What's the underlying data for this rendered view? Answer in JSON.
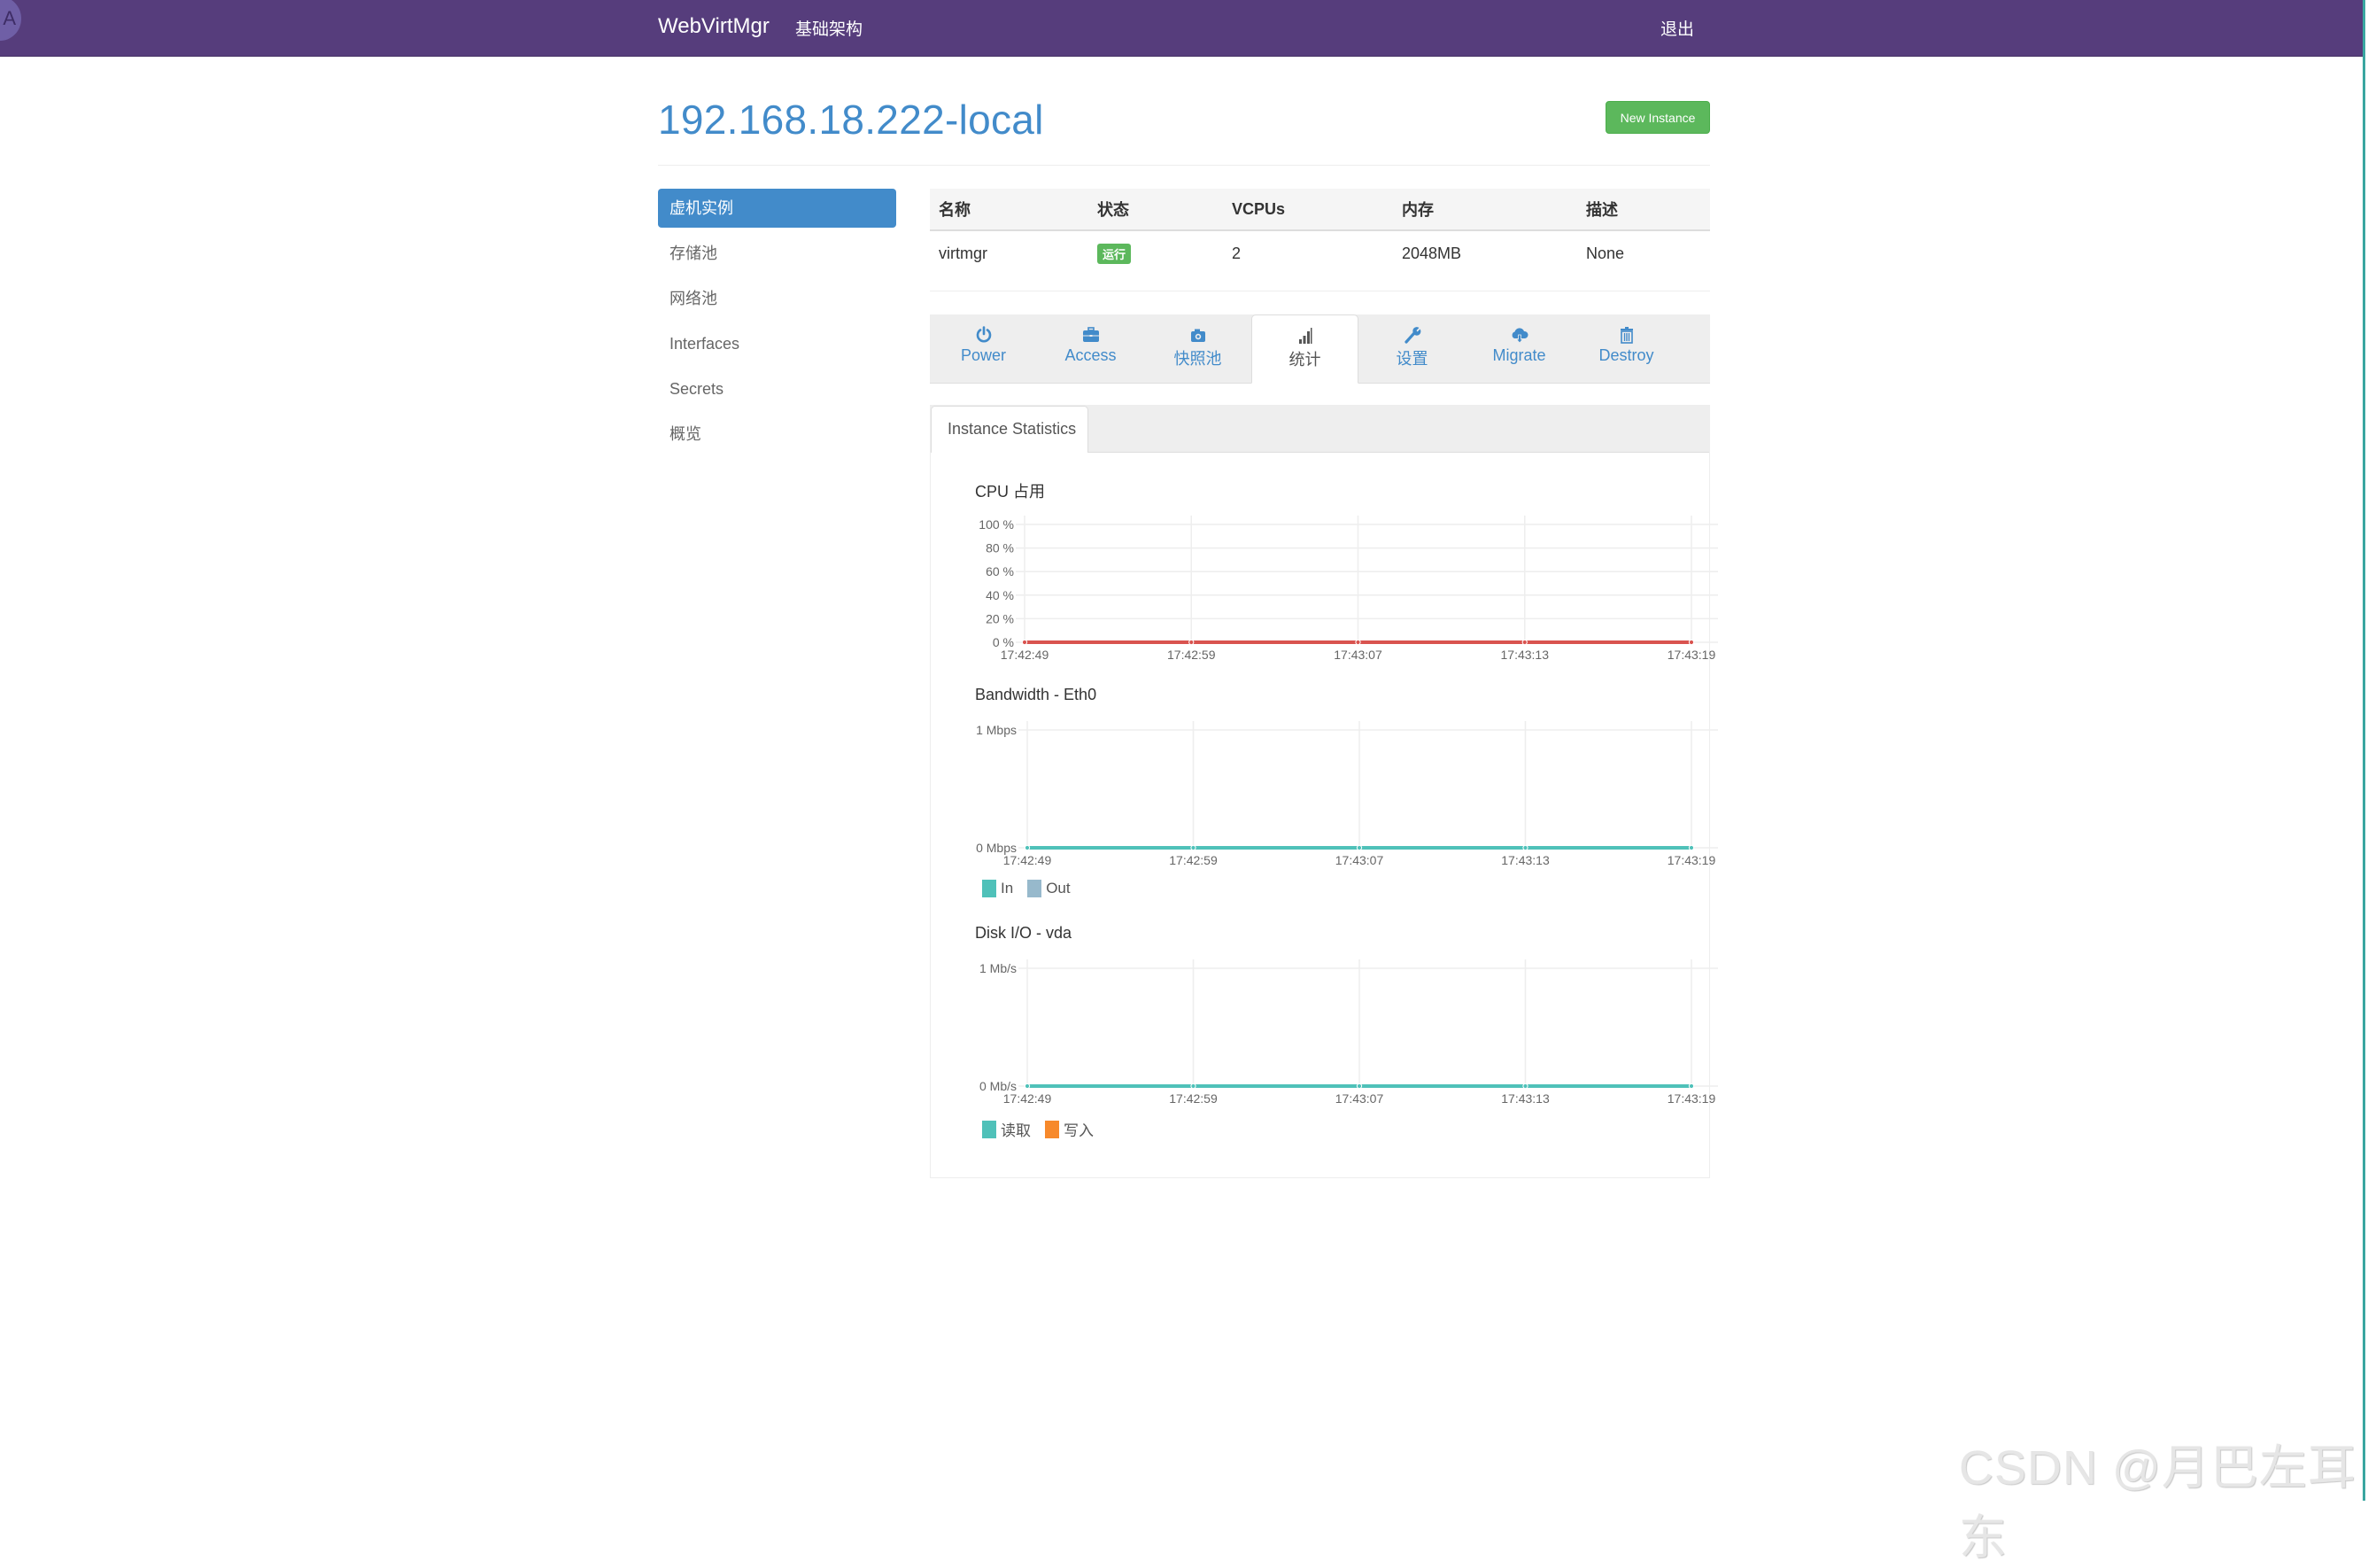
{
  "navbar": {
    "avatar_text": "A",
    "brand": "WebVirtMgr",
    "nav_link": "基础架构",
    "logout": "退出",
    "bg_color": "#563d7c"
  },
  "header": {
    "title": "192.168.18.222-local",
    "new_instance_label": "New Instance"
  },
  "sidebar": {
    "items": [
      {
        "label": "虚机实例",
        "active": true
      },
      {
        "label": "存储池",
        "active": false
      },
      {
        "label": "网络池",
        "active": false
      },
      {
        "label": "Interfaces",
        "active": false
      },
      {
        "label": "Secrets",
        "active": false
      },
      {
        "label": "概览",
        "active": false
      }
    ]
  },
  "instance_table": {
    "columns": [
      "名称",
      "状态",
      "VCPUs",
      "内存",
      "描述"
    ],
    "rows": [
      {
        "name": "virtmgr",
        "status": "运行",
        "vcpus": "2",
        "memory": "2048MB",
        "description": "None"
      }
    ]
  },
  "tabs": [
    {
      "label": "Power",
      "icon": "power-icon",
      "active": false
    },
    {
      "label": "Access",
      "icon": "briefcase-icon",
      "active": false
    },
    {
      "label": "快照池",
      "icon": "camera-icon",
      "active": false
    },
    {
      "label": "统计",
      "icon": "signal-bars-icon",
      "active": true
    },
    {
      "label": "设置",
      "icon": "wrench-icon",
      "active": false
    },
    {
      "label": "Migrate",
      "icon": "cloud-download-icon",
      "active": false
    },
    {
      "label": "Destroy",
      "icon": "trash-icon",
      "active": false
    }
  ],
  "stats_panel": {
    "tab_label": "Instance Statistics"
  },
  "chart_data": [
    {
      "type": "line",
      "title": "CPU 占用",
      "x": [
        "17:42:49",
        "17:42:59",
        "17:43:07",
        "17:43:13",
        "17:43:19"
      ],
      "yticks": [
        "0 %",
        "20 %",
        "40 %",
        "60 %",
        "80 %",
        "100 %"
      ],
      "ylim": [
        0,
        100
      ],
      "series": [
        {
          "name": "CPU",
          "color": "#d9534f",
          "values": [
            0,
            0,
            0,
            0,
            0
          ]
        }
      ],
      "grid": true,
      "legend": null
    },
    {
      "type": "line",
      "title": "Bandwidth - Eth0",
      "x": [
        "17:42:49",
        "17:42:59",
        "17:43:07",
        "17:43:13",
        "17:43:19"
      ],
      "yticks": [
        "0 Mbps",
        "1 Mbps"
      ],
      "ylim": [
        0,
        1
      ],
      "series": [
        {
          "name": "In",
          "color": "#4fc1b9",
          "values": [
            0,
            0,
            0,
            0,
            0
          ]
        },
        {
          "name": "Out",
          "color": "#97b9cc",
          "values": [
            0,
            0,
            0,
            0,
            0
          ]
        }
      ],
      "grid": true,
      "legend": "bottom-left"
    },
    {
      "type": "line",
      "title": "Disk I/O - vda",
      "x": [
        "17:42:49",
        "17:42:59",
        "17:43:07",
        "17:43:13",
        "17:43:19"
      ],
      "yticks": [
        "0 Mb/s",
        "1 Mb/s"
      ],
      "ylim": [
        0,
        1
      ],
      "series": [
        {
          "name": "读取",
          "color": "#4fc1b9",
          "values": [
            0,
            0,
            0,
            0,
            0
          ]
        },
        {
          "name": "写入",
          "color": "#f7892b",
          "values": [
            0,
            0,
            0,
            0,
            0
          ]
        }
      ],
      "grid": true,
      "legend": "bottom-left"
    }
  ],
  "watermark": "CSDN @月巴左耳东"
}
